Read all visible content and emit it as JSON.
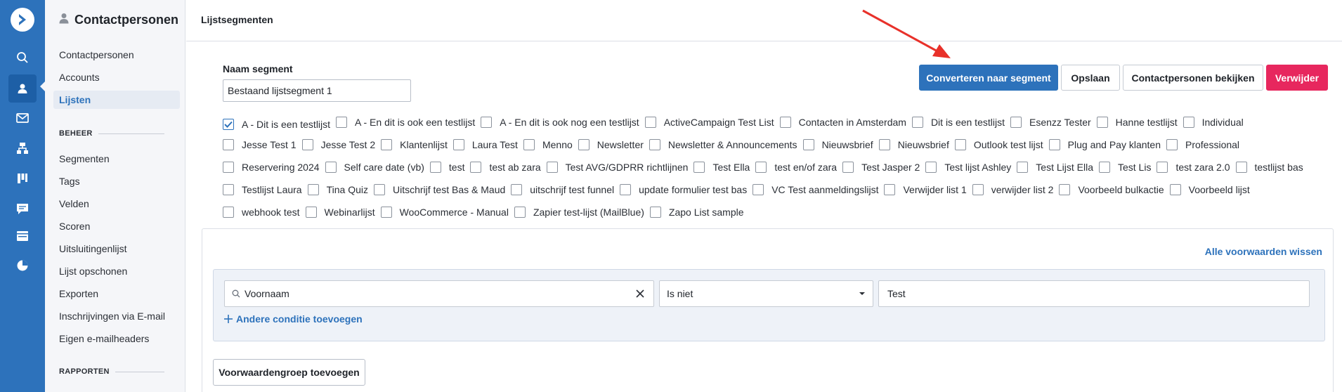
{
  "rail": {
    "icons": [
      "logo-icon",
      "search-icon",
      "contacts-icon",
      "email-icon",
      "automations-icon",
      "deals-icon",
      "conversations-icon",
      "website-icon",
      "reports-icon"
    ]
  },
  "sidebar": {
    "title": "Contactpersonen",
    "items": [
      "Contactpersonen",
      "Accounts",
      "Lijsten"
    ],
    "active_item": "Lijsten",
    "section_beheer": "BEHEER",
    "beheer_items": [
      "Segmenten",
      "Tags",
      "Velden",
      "Scoren",
      "Uitsluitingenlijst",
      "Lijst opschonen",
      "Exporten",
      "Inschrijvingen via E-mail",
      "Eigen e-mailheaders"
    ],
    "section_rapporten": "RAPPORTEN"
  },
  "header": {
    "title": "Lijstsegmenten"
  },
  "segment": {
    "label": "Naam segment",
    "value": "Bestaand lijstsegment 1"
  },
  "actions": {
    "convert": "Converteren naar segment",
    "save": "Opslaan",
    "view_contacts": "Contactpersonen bekijken",
    "delete": "Verwijder"
  },
  "lists": {
    "rows": [
      [
        {
          "label": "A - Dit is een testlijst",
          "checked": true
        },
        {
          "label": "A - En dit is ook een testlijst",
          "checked": false
        },
        {
          "label": "A - En dit is ook nog een testlijst",
          "checked": false
        },
        {
          "label": "ActiveCampaign Test List",
          "checked": false
        },
        {
          "label": "Contacten in Amsterdam",
          "checked": false
        },
        {
          "label": "Dit is een testlijst",
          "checked": false
        },
        {
          "label": "Esenzz Tester",
          "checked": false
        },
        {
          "label": "Hanne testlijst",
          "checked": false
        },
        {
          "label": "Individual",
          "checked": false
        }
      ],
      [
        {
          "label": "Jesse Test 1",
          "checked": false
        },
        {
          "label": "Jesse Test 2",
          "checked": false
        },
        {
          "label": "Klantenlijst",
          "checked": false
        },
        {
          "label": "Laura Test",
          "checked": false
        },
        {
          "label": "Menno",
          "checked": false
        },
        {
          "label": "Newsletter",
          "checked": false
        },
        {
          "label": "Newsletter & Announcements",
          "checked": false
        },
        {
          "label": "Nieuwsbrief",
          "checked": false
        },
        {
          "label": "Nieuwsbrief",
          "checked": false
        },
        {
          "label": "Outlook test lijst",
          "checked": false
        },
        {
          "label": "Plug and Pay klanten",
          "checked": false
        },
        {
          "label": "Professional",
          "checked": false
        }
      ],
      [
        {
          "label": "Reservering 2024",
          "checked": false
        },
        {
          "label": "Self care date (vb)",
          "checked": false
        },
        {
          "label": "test",
          "checked": false
        },
        {
          "label": "test ab zara",
          "checked": false
        },
        {
          "label": "Test AVG/GDPRR richtlijnen",
          "checked": false
        },
        {
          "label": "Test Ella",
          "checked": false
        },
        {
          "label": "test en/of zara",
          "checked": false
        },
        {
          "label": "Test Jasper 2",
          "checked": false
        },
        {
          "label": "Test lijst Ashley",
          "checked": false
        },
        {
          "label": "Test Lijst Ella",
          "checked": false
        },
        {
          "label": "Test Lis",
          "checked": false
        },
        {
          "label": "test zara 2.0",
          "checked": false
        },
        {
          "label": "testlijst bas",
          "checked": false
        }
      ],
      [
        {
          "label": "Testlijst Laura",
          "checked": false
        },
        {
          "label": "Tina Quiz",
          "checked": false
        },
        {
          "label": "Uitschrijf test Bas & Maud",
          "checked": false
        },
        {
          "label": "uitschrijf test funnel",
          "checked": false
        },
        {
          "label": "update formulier test bas",
          "checked": false
        },
        {
          "label": "VC Test aanmeldingslijst",
          "checked": false
        },
        {
          "label": "Verwijder list 1",
          "checked": false
        },
        {
          "label": "verwijder list 2",
          "checked": false
        },
        {
          "label": "Voorbeeld bulkactie",
          "checked": false
        },
        {
          "label": "Voorbeeld lijst",
          "checked": false
        }
      ],
      [
        {
          "label": "webhook test",
          "checked": false
        },
        {
          "label": "Webinarlijst",
          "checked": false
        },
        {
          "label": "WooCommerce - Manual",
          "checked": false
        },
        {
          "label": "Zapier test-lijst (MailBlue)",
          "checked": false
        },
        {
          "label": "Zapo List sample",
          "checked": false
        }
      ]
    ]
  },
  "conditions": {
    "clear_all": "Alle voorwaarden wissen",
    "field": "Voornaam",
    "operator": "Is niet",
    "value": "Test",
    "add_condition": "Andere conditie toevoegen",
    "add_group": "Voorwaardengroep toevoegen"
  },
  "colors": {
    "brand": "#2d72bb",
    "danger": "#e7275e",
    "annotation_arrow": "#e8312a"
  }
}
